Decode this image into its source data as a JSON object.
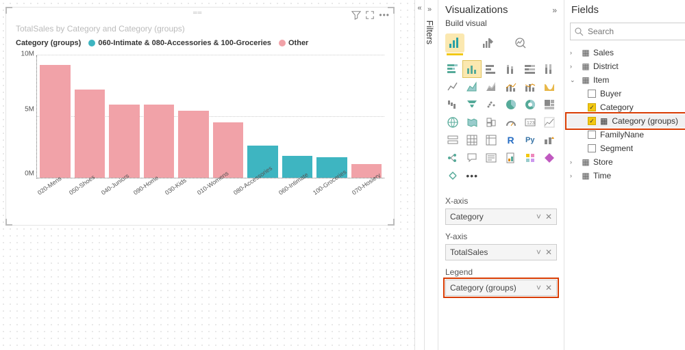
{
  "chart_data": {
    "type": "bar",
    "title": "TotalSales by Category and Category (groups)",
    "ylabel": "TotalSales",
    "ylim": [
      0,
      10000000
    ],
    "yticks": [
      "0M",
      "5M",
      "10M"
    ],
    "legend_title": "Category (groups)",
    "series_names": [
      "060-Intimate & 080-Accessories & 100-Groceries",
      "Other"
    ],
    "categories": [
      "020-Mens",
      "050-Shoes",
      "040-Juniors",
      "090-Home",
      "030-Kids",
      "010-Womens",
      "080-Accessories",
      "060-Intimate",
      "100-Groceries",
      "070-Hosiery"
    ],
    "values": [
      9200000,
      7200000,
      6000000,
      6000000,
      5500000,
      4500000,
      2600000,
      1800000,
      1700000,
      1100000
    ],
    "group": [
      "Other",
      "Other",
      "Other",
      "Other",
      "Other",
      "Other",
      "060",
      "060",
      "060",
      "Other"
    ]
  },
  "legend": {
    "s1": "060-Intimate & 080-Accessories & 100-Groceries",
    "s2": "Other"
  },
  "colors": {
    "s1": "#3eb5c1",
    "s2": "#f1a2a8"
  },
  "filters_label": "Filters",
  "viz": {
    "title": "Visualizations",
    "sub": "Build visual",
    "wells": {
      "x": {
        "label": "X-axis",
        "value": "Category"
      },
      "y": {
        "label": "Y-axis",
        "value": "TotalSales"
      },
      "legend": {
        "label": "Legend",
        "value": "Category (groups)"
      }
    }
  },
  "fields": {
    "title": "Fields",
    "search_placeholder": "Search",
    "tables": [
      {
        "name": "Sales",
        "open": false
      },
      {
        "name": "District",
        "open": false
      },
      {
        "name": "Item",
        "open": true,
        "cols": [
          {
            "name": "Buyer",
            "checked": false
          },
          {
            "name": "Category",
            "checked": true
          },
          {
            "name": "Category (groups)",
            "checked": true,
            "hl": true,
            "icon": "group"
          },
          {
            "name": "FamilyNane",
            "checked": false
          },
          {
            "name": "Segment",
            "checked": false
          }
        ]
      },
      {
        "name": "Store",
        "open": false
      },
      {
        "name": "Time",
        "open": false
      }
    ]
  }
}
